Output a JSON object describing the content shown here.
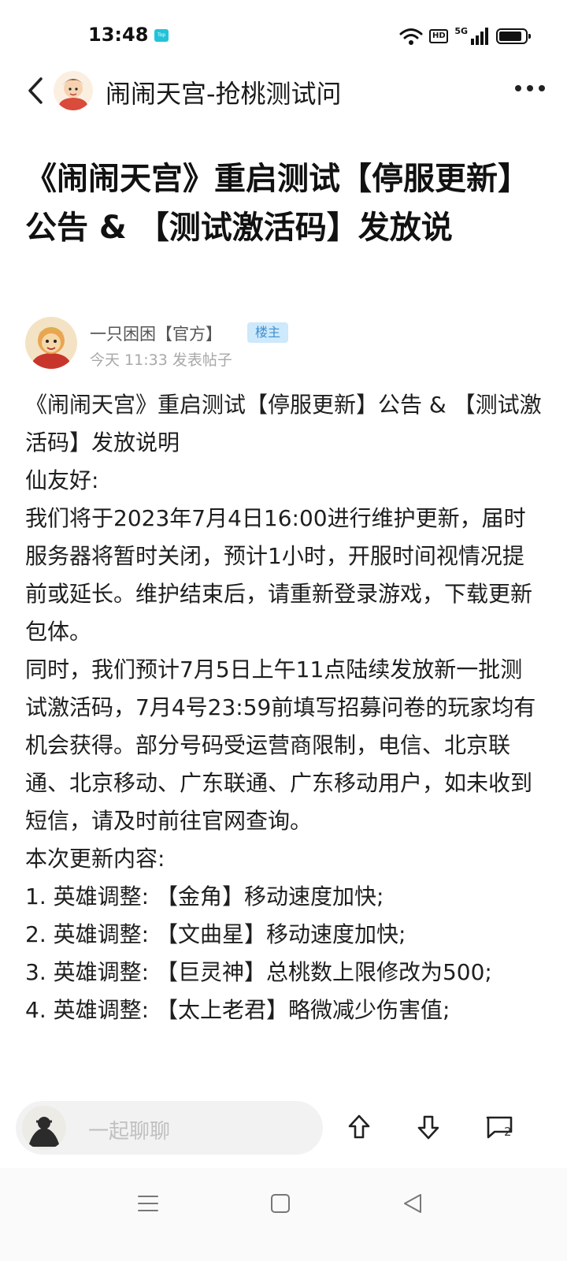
{
  "status_bar": {
    "time": "13:48",
    "app_indicator": "Top",
    "hd_label": "HD",
    "network_label": "5G",
    "battery_level": 0.9
  },
  "header": {
    "title": "闹闹天宫-抢桃测试问",
    "back_icon": "chevron-left-icon",
    "more_icon": "more-horizontal-icon"
  },
  "post": {
    "title": "《闹闹天宫》重启测试【停服更新】公告 & 【测试激活码】发放说",
    "author": {
      "name": "一只困困【官方】",
      "badge": "楼主",
      "meta": "今天 11:33 发表帖子"
    },
    "body": [
      "《闹闹天宫》重启测试【停服更新】公告 & 【测试激活码】发放说明",
      "仙友好:",
      "我们将于2023年7月4日16:00进行维护更新，届时服务器将暂时关闭，预计1小时，开服时间视情况提前或延长。维护结束后，请重新登录游戏，下载更新包体。",
      "同时，我们预计7月5日上午11点陆续发放新一批测试激活码，7月4号23:59前填写招募问卷的玩家均有机会获得。部分号码受运营商限制，电信、北京联通、北京移动、广东联通、广东移动用户，如未收到短信，请及时前往官网查询。",
      "本次更新内容:",
      "1. 英雄调整: 【金角】移动速度加快;",
      "2. 英雄调整: 【文曲星】移动速度加快;",
      "3. 英雄调整: 【巨灵神】总桃数上限修改为500;",
      "4. 英雄调整: 【太上老君】略微减少伤害值;"
    ]
  },
  "bottom_bar": {
    "chat_placeholder": "一起聊聊",
    "comment_count": "2",
    "icons": [
      "arrow-up-icon",
      "arrow-down-icon",
      "comment-icon"
    ]
  },
  "nav_bar": {
    "icons": [
      "menu-icon",
      "home-square-icon",
      "back-triangle-icon"
    ]
  },
  "colors": {
    "badge_bg": "#cde9fb",
    "badge_text": "#3d8fcf",
    "chat_box_bg": "#f2f2f2",
    "app_indicator": "#22c3d8"
  }
}
